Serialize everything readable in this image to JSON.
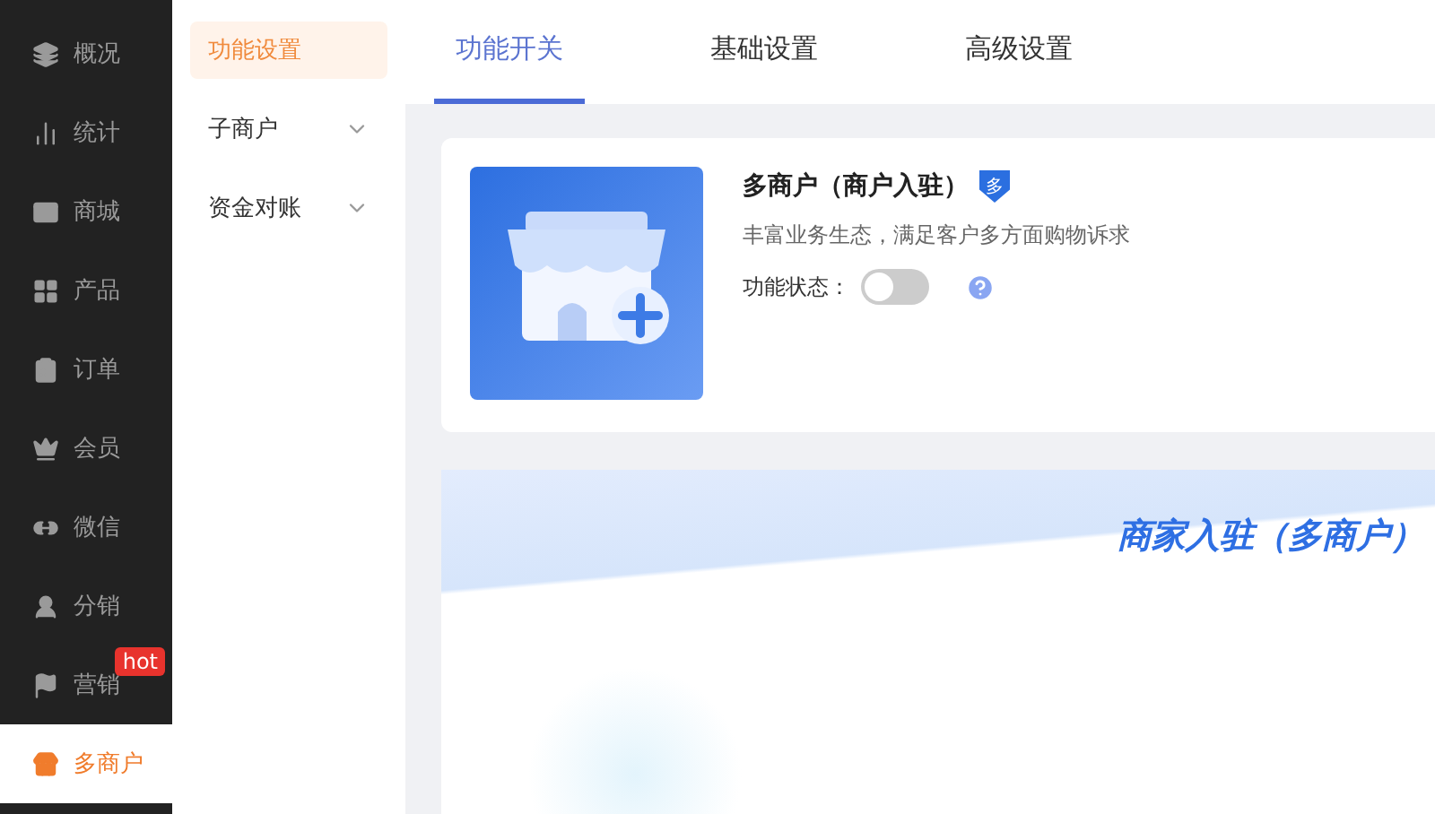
{
  "main_nav": {
    "items": [
      {
        "label": "概况",
        "selected": false
      },
      {
        "label": "统计",
        "selected": false
      },
      {
        "label": "商城",
        "selected": false
      },
      {
        "label": "产品",
        "selected": false
      },
      {
        "label": "订单",
        "selected": false
      },
      {
        "label": "会员",
        "selected": false
      },
      {
        "label": "微信",
        "selected": false
      },
      {
        "label": "分销",
        "selected": false
      },
      {
        "label": "营销",
        "selected": false,
        "badge": "hot"
      },
      {
        "label": "多商户",
        "selected": true
      }
    ]
  },
  "sub_nav": {
    "items": [
      {
        "label": "功能设置",
        "selected": true
      },
      {
        "label": "子商户",
        "selected": false,
        "expanded": false
      },
      {
        "label": "资金对账",
        "selected": false,
        "expanded": false
      }
    ]
  },
  "tabs": [
    {
      "label": "功能开关",
      "selected": true
    },
    {
      "label": "基础设置",
      "selected": false
    },
    {
      "label": "高级设置",
      "selected": false
    }
  ],
  "feature_card": {
    "title": "多商户（商户入驻）",
    "badge": "多",
    "description": "丰富业务生态，满足客户多方面购物诉求",
    "status_label": "功能状态：",
    "on": false
  },
  "banner": {
    "title": "商家入驻（多商户）"
  }
}
